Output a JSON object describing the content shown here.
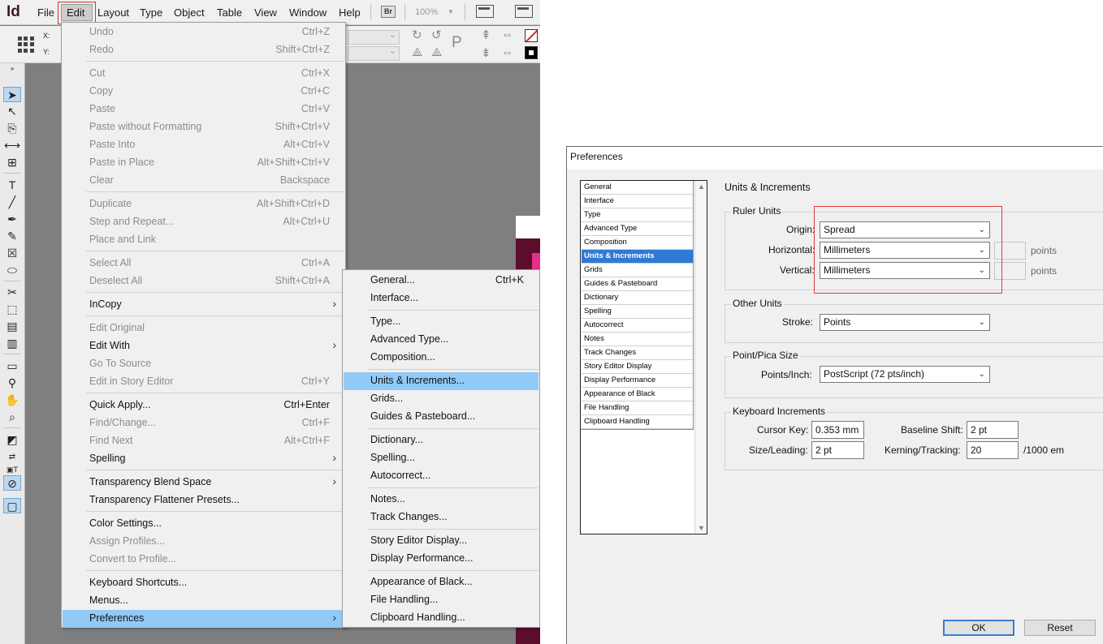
{
  "app": {
    "logo": "Id",
    "menus": [
      "File",
      "Edit",
      "Layout",
      "Type",
      "Object",
      "Table",
      "View",
      "Window",
      "Help"
    ],
    "bridge_badge": "Br",
    "zoom": "100%",
    "xy": {
      "x_label": "X:",
      "y_label": "Y:"
    },
    "proxy_glyph": "P"
  },
  "edit_menu": {
    "items": [
      {
        "label": "Undo",
        "shortcut": "Ctrl+Z",
        "disabled": true
      },
      {
        "label": "Redo",
        "shortcut": "Shift+Ctrl+Z",
        "disabled": true
      },
      {
        "label": "Cut",
        "shortcut": "Ctrl+X",
        "disabled": true
      },
      {
        "label": "Copy",
        "shortcut": "Ctrl+C",
        "disabled": true
      },
      {
        "label": "Paste",
        "shortcut": "Ctrl+V",
        "disabled": true
      },
      {
        "label": "Paste without Formatting",
        "shortcut": "Shift+Ctrl+V",
        "disabled": true
      },
      {
        "label": "Paste Into",
        "shortcut": "Alt+Ctrl+V",
        "disabled": true
      },
      {
        "label": "Paste in Place",
        "shortcut": "Alt+Shift+Ctrl+V",
        "disabled": true
      },
      {
        "label": "Clear",
        "shortcut": "Backspace",
        "disabled": true
      },
      {
        "label": "Duplicate",
        "shortcut": "Alt+Shift+Ctrl+D",
        "disabled": true
      },
      {
        "label": "Step and Repeat...",
        "shortcut": "Alt+Ctrl+U",
        "disabled": true
      },
      {
        "label": "Place and Link",
        "shortcut": "",
        "disabled": true
      },
      {
        "label": "Select All",
        "shortcut": "Ctrl+A",
        "disabled": true
      },
      {
        "label": "Deselect All",
        "shortcut": "Shift+Ctrl+A",
        "disabled": true
      },
      {
        "label": "InCopy",
        "shortcut": "",
        "disabled": false
      },
      {
        "label": "Edit Original",
        "shortcut": "",
        "disabled": true
      },
      {
        "label": "Edit With",
        "shortcut": "",
        "disabled": false
      },
      {
        "label": "Go To Source",
        "shortcut": "",
        "disabled": true
      },
      {
        "label": "Edit in Story Editor",
        "shortcut": "Ctrl+Y",
        "disabled": true
      },
      {
        "label": "Quick Apply...",
        "shortcut": "Ctrl+Enter",
        "disabled": false
      },
      {
        "label": "Find/Change...",
        "shortcut": "Ctrl+F",
        "disabled": true
      },
      {
        "label": "Find Next",
        "shortcut": "Alt+Ctrl+F",
        "disabled": true
      },
      {
        "label": "Spelling",
        "shortcut": "",
        "disabled": false
      },
      {
        "label": "Transparency Blend Space",
        "shortcut": "",
        "disabled": false
      },
      {
        "label": "Transparency Flattener Presets...",
        "shortcut": "",
        "disabled": false
      },
      {
        "label": "Color Settings...",
        "shortcut": "",
        "disabled": false
      },
      {
        "label": "Assign Profiles...",
        "shortcut": "",
        "disabled": true
      },
      {
        "label": "Convert to Profile...",
        "shortcut": "",
        "disabled": true
      },
      {
        "label": "Keyboard Shortcuts...",
        "shortcut": "",
        "disabled": false
      },
      {
        "label": "Menus...",
        "shortcut": "",
        "disabled": false
      },
      {
        "label": "Preferences",
        "shortcut": "",
        "disabled": false
      }
    ]
  },
  "prefs_submenu": {
    "items": [
      {
        "label": "General...",
        "shortcut": "Ctrl+K"
      },
      {
        "label": "Interface...",
        "shortcut": ""
      },
      {
        "label": "Type...",
        "shortcut": ""
      },
      {
        "label": "Advanced Type...",
        "shortcut": ""
      },
      {
        "label": "Composition...",
        "shortcut": ""
      },
      {
        "label": "Units & Increments...",
        "shortcut": ""
      },
      {
        "label": "Grids...",
        "shortcut": ""
      },
      {
        "label": "Guides & Pasteboard...",
        "shortcut": ""
      },
      {
        "label": "Dictionary...",
        "shortcut": ""
      },
      {
        "label": "Spelling...",
        "shortcut": ""
      },
      {
        "label": "Autocorrect...",
        "shortcut": ""
      },
      {
        "label": "Notes...",
        "shortcut": ""
      },
      {
        "label": "Track Changes...",
        "shortcut": ""
      },
      {
        "label": "Story Editor Display...",
        "shortcut": ""
      },
      {
        "label": "Display Performance...",
        "shortcut": ""
      },
      {
        "label": "Appearance of Black...",
        "shortcut": ""
      },
      {
        "label": "File Handling...",
        "shortcut": ""
      },
      {
        "label": "Clipboard Handling...",
        "shortcut": ""
      }
    ]
  },
  "dialog": {
    "title": "Preferences",
    "categories": [
      "General",
      "Interface",
      "Type",
      "Advanced Type",
      "Composition",
      "Units & Increments",
      "Grids",
      "Guides & Pasteboard",
      "Dictionary",
      "Spelling",
      "Autocorrect",
      "Notes",
      "Track Changes",
      "Story Editor Display",
      "Display Performance",
      "Appearance of Black",
      "File Handling",
      "Clipboard Handling"
    ],
    "selected_category": "Units & Increments",
    "section_title": "Units & Increments",
    "ruler_units": {
      "title": "Ruler Units",
      "origin_label": "Origin:",
      "origin_value": "Spread",
      "horizontal_label": "Horizontal:",
      "horizontal_value": "Millimeters",
      "horizontal_unit": "points",
      "vertical_label": "Vertical:",
      "vertical_value": "Millimeters",
      "vertical_unit": "points"
    },
    "other_units": {
      "title": "Other Units",
      "stroke_label": "Stroke:",
      "stroke_value": "Points"
    },
    "point_pica": {
      "title": "Point/Pica Size",
      "label": "Points/Inch:",
      "value": "PostScript (72 pts/inch)"
    },
    "keyboard": {
      "title": "Keyboard Increments",
      "cursor_label": "Cursor Key:",
      "cursor_value": "0.353 mm",
      "baseline_label": "Baseline Shift:",
      "baseline_value": "2 pt",
      "size_label": "Size/Leading:",
      "size_value": "2 pt",
      "kerning_label": "Kerning/Tracking:",
      "kerning_value": "20",
      "kerning_unit": "/1000 em"
    },
    "ok_label": "OK",
    "reset_label": "Reset"
  }
}
